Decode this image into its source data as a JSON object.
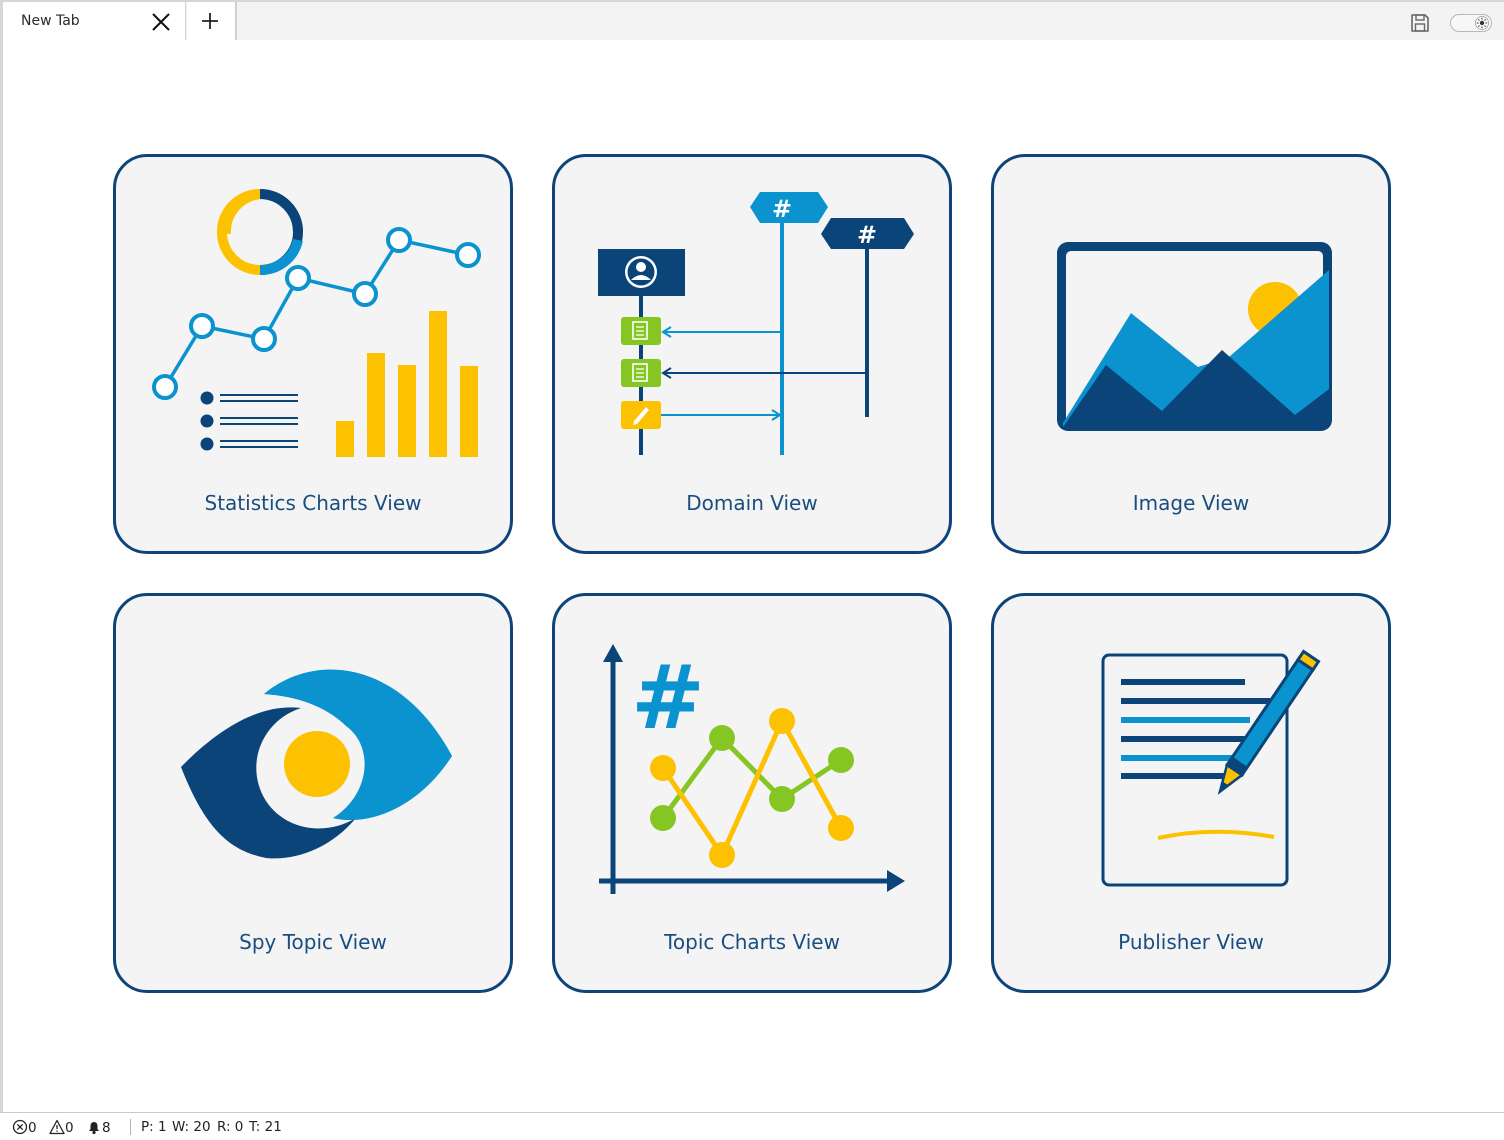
{
  "tabs": [
    {
      "label": "New Tab"
    }
  ],
  "cards": [
    {
      "label": "Statistics Charts View",
      "icon": "statistics-charts-icon"
    },
    {
      "label": "Domain View",
      "icon": "domain-icon"
    },
    {
      "label": "Image View",
      "icon": "image-icon"
    },
    {
      "label": "Spy Topic View",
      "icon": "eye-icon"
    },
    {
      "label": "Topic Charts View",
      "icon": "topic-chart-icon"
    },
    {
      "label": "Publisher View",
      "icon": "publisher-icon"
    }
  ],
  "statusbar": {
    "errors": "0",
    "warnings": "0",
    "notifications": "8",
    "p": "P: 1",
    "w": "W: 20",
    "r": "R: 0",
    "t": "T: 21"
  },
  "colors": {
    "navy": "#0b4479",
    "blue": "#0a93cf",
    "yellow": "#fcc101",
    "green": "#86c623",
    "card_bg": "#f4f4f5"
  }
}
